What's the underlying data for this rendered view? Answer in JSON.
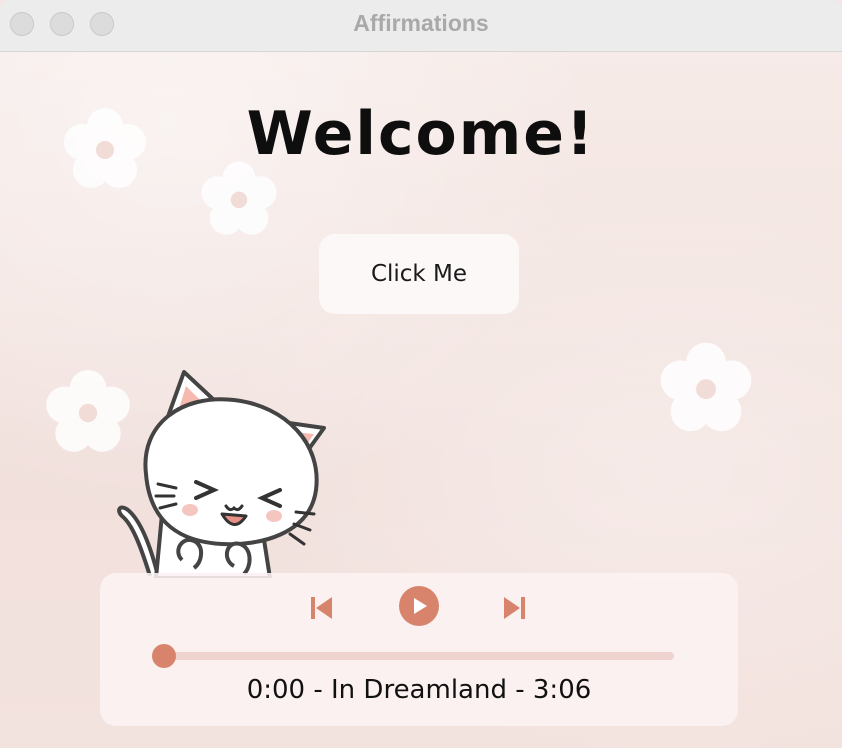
{
  "window": {
    "title": "Affirmations",
    "traffic_lights": [
      "close",
      "minimize",
      "zoom"
    ]
  },
  "main": {
    "heading": "Welcome!",
    "button_label": "Click Me",
    "illustration": "cat-illustration",
    "decorations": [
      "flower-icon",
      "flower-icon",
      "flower-icon",
      "flower-icon"
    ]
  },
  "player": {
    "controls": {
      "previous_icon": "skip-previous-icon",
      "play_icon": "play-icon",
      "next_icon": "skip-next-icon"
    },
    "elapsed": "0:00",
    "separator": "-",
    "track_title": "In Dreamland",
    "duration": "3:06",
    "progress": 0.0
  },
  "colors": {
    "accent": "#d8846c",
    "track": "#efd3cf",
    "background": "#f3e6e4",
    "button_bg": "#fdf8f8"
  }
}
